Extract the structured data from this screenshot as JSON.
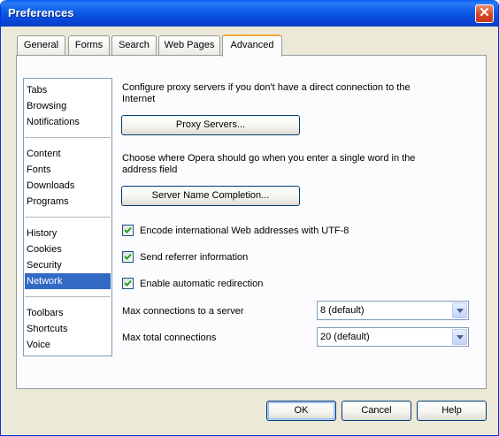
{
  "window": {
    "title": "Preferences",
    "close_symbol": "✕"
  },
  "tabs": [
    {
      "label": "General"
    },
    {
      "label": "Forms"
    },
    {
      "label": "Search"
    },
    {
      "label": "Web Pages"
    },
    {
      "label": "Advanced",
      "active": true
    }
  ],
  "categories": [
    {
      "label": "Tabs"
    },
    {
      "label": "Browsing"
    },
    {
      "label": "Notifications"
    },
    {
      "label": "Content"
    },
    {
      "label": "Fonts"
    },
    {
      "label": "Downloads"
    },
    {
      "label": "Programs"
    },
    {
      "label": "History"
    },
    {
      "label": "Cookies"
    },
    {
      "label": "Security"
    },
    {
      "label": "Network",
      "selected": true
    },
    {
      "label": "Toolbars"
    },
    {
      "label": "Shortcuts"
    },
    {
      "label": "Voice"
    }
  ],
  "network": {
    "proxy_desc": [
      "Configure proxy servers if you don't have a direct connection to the",
      "Internet"
    ],
    "proxy_button": "Proxy Servers...",
    "completion_desc": [
      "Choose where Opera should go when you enter a single word in the",
      "address field"
    ],
    "completion_button": "Server Name Completion...",
    "checkboxes": [
      {
        "label": "Encode international Web addresses with UTF-8",
        "checked": true
      },
      {
        "label": "Send referrer information",
        "checked": true
      },
      {
        "label": "Enable automatic redirection",
        "checked": true
      }
    ],
    "max_conn_server": {
      "label": "Max connections to a server",
      "value": "8 (default)"
    },
    "max_total_conn": {
      "label": "Max total connections",
      "value": "20 (default)"
    }
  },
  "buttons": {
    "ok": "OK",
    "cancel": "Cancel",
    "help": "Help"
  },
  "colors": {
    "titlebar": "#0a5be8",
    "selection": "#316ac5",
    "face": "#ece9d8",
    "active_tab_accent": "#f2a83c"
  }
}
